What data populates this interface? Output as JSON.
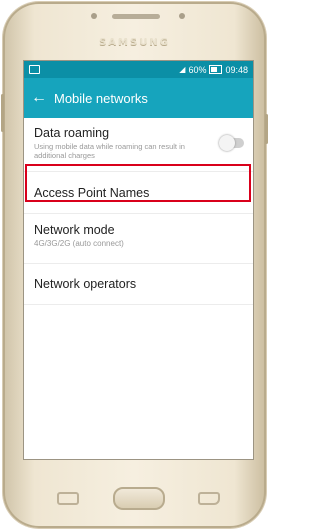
{
  "device": {
    "brand": "SAMSUNG"
  },
  "status_bar": {
    "battery": "60%",
    "time": "09:48",
    "signal_icon": "signal-icon",
    "image_icon": "image-icon"
  },
  "app_bar": {
    "back_icon": "back-arrow-icon",
    "title": "Mobile networks"
  },
  "settings": {
    "data_roaming": {
      "label": "Data roaming",
      "description": "Using mobile data while roaming can result in additional charges",
      "enabled": false
    },
    "access_point_names": {
      "label": "Access Point Names",
      "highlighted": true
    },
    "network_mode": {
      "label": "Network mode",
      "value": "4G/3G/2G (auto connect)"
    },
    "network_operators": {
      "label": "Network operators"
    }
  },
  "colors": {
    "status_bar": "#0b8fa6",
    "app_bar": "#16a4bd",
    "highlight": "#d9001b"
  }
}
